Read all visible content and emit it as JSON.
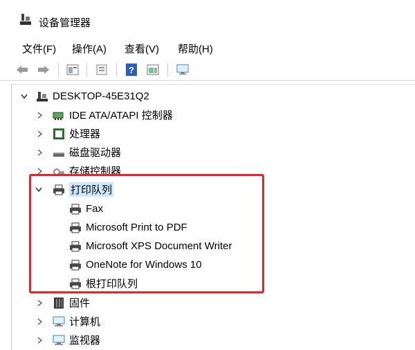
{
  "window": {
    "title": "设备管理器"
  },
  "menu": [
    "文件(F)",
    "操作(A)",
    "查看(V)",
    "帮助(H)"
  ],
  "toolbar": [
    "back-arrow-icon",
    "forward-arrow-icon",
    "properties-icon",
    "update-icon",
    "help-icon",
    "view-icon",
    "monitor-icon"
  ],
  "tree": {
    "root": "DESKTOP-45E31Q2",
    "categories": [
      {
        "label": "IDE ATA/ATAPI 控制器",
        "icon": "ide-controller-icon",
        "expanded": false
      },
      {
        "label": "处理器",
        "icon": "processor-icon",
        "expanded": false
      },
      {
        "label": "磁盘驱动器",
        "icon": "disk-drive-icon",
        "expanded": false
      },
      {
        "label": "存储控制器",
        "icon": "storage-controller-icon",
        "expanded": false
      },
      {
        "label": "打印队列",
        "icon": "printer-icon",
        "expanded": true,
        "children": [
          "Fax",
          "Microsoft Print to PDF",
          "Microsoft XPS Document Writer",
          "OneNote for Windows 10",
          "根打印队列"
        ]
      },
      {
        "label": "固件",
        "icon": "firmware-icon",
        "expanded": false
      },
      {
        "label": "计算机",
        "icon": "computer-icon",
        "expanded": false
      },
      {
        "label": "监视器",
        "icon": "monitor-icon",
        "expanded": false
      }
    ]
  },
  "colors": {
    "highlight_border": "#e0262f",
    "selection": "#cce8ff"
  }
}
